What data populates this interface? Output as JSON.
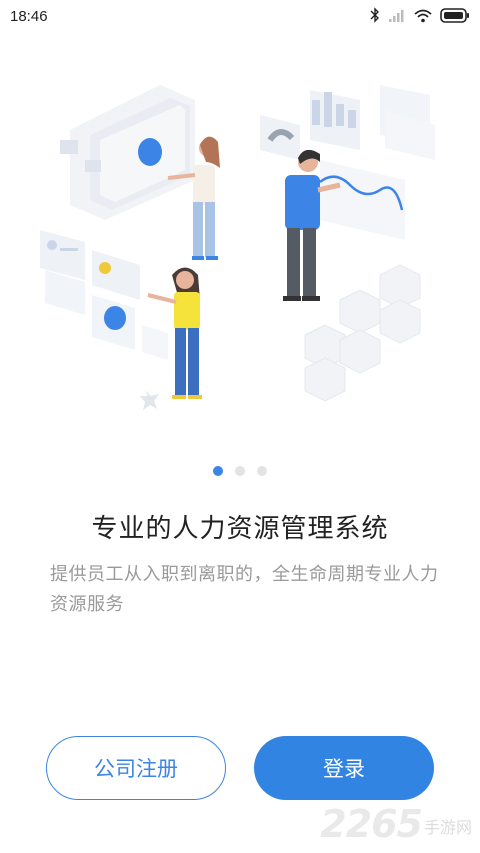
{
  "status_bar": {
    "time": "18:46",
    "icons": [
      "bluetooth-icon",
      "signal-icon",
      "wifi-icon",
      "battery-icon"
    ]
  },
  "pager": {
    "count": 3,
    "active_index": 0
  },
  "onboarding": {
    "title": "专业的人力资源管理系统",
    "subtitle": "提供员工从入职到离职的，全生命周期专业人力资源服务"
  },
  "actions": {
    "register_label": "公司注册",
    "login_label": "登录"
  },
  "watermark": {
    "number": "2265",
    "text": "手游网"
  },
  "colors": {
    "accent": "#3284e3",
    "dot_inactive": "#e3e3e3",
    "subtitle": "#9a9a9a"
  }
}
